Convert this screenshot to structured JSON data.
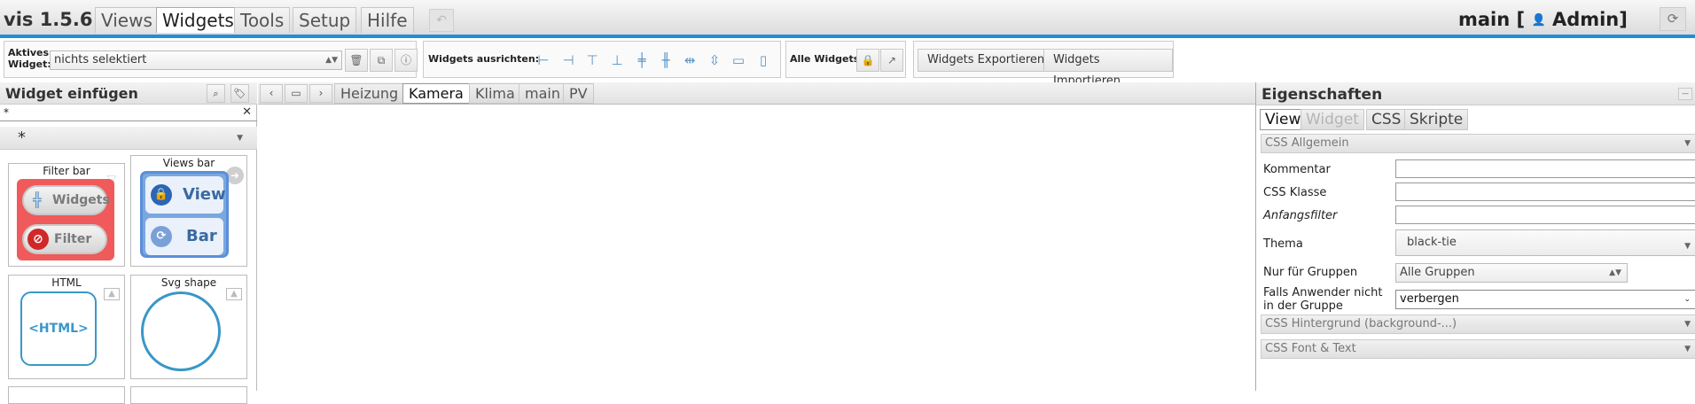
{
  "app": {
    "title": "vis 1.5.6"
  },
  "menu": {
    "tabs": [
      "Views",
      "Widgets",
      "Tools",
      "Setup",
      "Hilfe"
    ],
    "active": "Widgets",
    "user_prefix": "main [",
    "user_name": "Admin]"
  },
  "toolbar": {
    "active_widget_label_1": "Aktives",
    "active_widget_label_2": "Widget:",
    "active_widget_value": "nichts selektiert",
    "align_label": "Widgets ausrichten:",
    "all_widgets_label": "Alle Widgets:",
    "export_label": "Widgets Exportieren",
    "import_label": "Widgets Importieren"
  },
  "left_panel": {
    "title": "Widget einfügen",
    "filter_value": "*",
    "widget_set": "*",
    "widgets": [
      {
        "name": "Filter bar",
        "pill1": "Widgets",
        "pill2": "Filter"
      },
      {
        "name": "Views bar",
        "pill1": "View",
        "pill2": "Bar"
      },
      {
        "name": "HTML",
        "preview": "<HTML>"
      },
      {
        "name": "Svg shape"
      }
    ]
  },
  "center": {
    "view_tabs": [
      "Heizung",
      "Kamera",
      "Klima",
      "main",
      "PV"
    ],
    "active_view": "Kamera"
  },
  "right_panel": {
    "title": "Eigenschaften",
    "tabs": [
      "View",
      "Widget",
      "CSS",
      "Skripte"
    ],
    "active_tab": "View",
    "disabled_tab": "Widget",
    "section_general": "CSS Allgemein",
    "fields": {
      "comment": "Kommentar",
      "css_class": "CSS Klasse",
      "init_filter": "Anfangsfilter",
      "theme": "Thema",
      "theme_value": "black-tie",
      "groups": "Nur für Gruppen",
      "groups_value": "Alle Gruppen",
      "not_in_group_1": "Falls Anwender nicht",
      "not_in_group_2": "in der Gruppe",
      "not_in_group_value": "verbergen"
    },
    "section_background": "CSS Hintergrund (background-...)",
    "section_font": "CSS Font & Text"
  },
  "colors": {
    "accent": "#1f8fd8",
    "filter_bar_red": "#f05a5a",
    "views_bar_blue": "#5b8fd8",
    "html_blue": "#3a97c8"
  }
}
